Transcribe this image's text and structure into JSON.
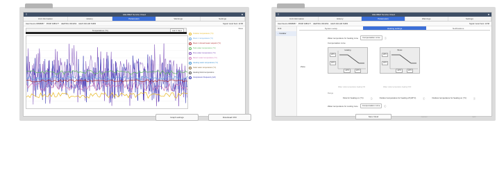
{
  "left": {
    "title": "HELIMEX Service Cloud",
    "nav": [
      "Unit information",
      "History",
      "Parameters",
      "Warnings",
      "Settings"
    ],
    "nav_active": 2,
    "sub": [
      "Heat Source 06686857",
      "PUMP 0486177",
      "HEATING 003145A",
      "HEAT AIR-AIR 51683"
    ],
    "sub_right": "Signal: Good  Sent: 13:58",
    "chart_title": "Temperatures (°C)",
    "range_label": "Last 2 days",
    "legend_header": "Show",
    "legend": [
      {
        "label": "Outdoor temperature (°C)",
        "color": "#e8b820"
      },
      {
        "label": "Room 1 temperature (°C)",
        "color": "#6aa8e0"
      },
      {
        "label": "Room 1 Actual heater setpoint (°C)",
        "color": "#b03030"
      },
      {
        "label": "Tank water temperature (°C)",
        "color": "#5fb85f"
      },
      {
        "label": "Flow water temperature (°C)",
        "color": "#7a4ab8"
      },
      {
        "label": "Return water temperature (°C)",
        "color": "#d07ab8"
      },
      {
        "label": "Heating water temperature (°C)",
        "color": "#3b8fd0"
      },
      {
        "label": "Solar water temperature (°C)",
        "color": "#8a6a3a"
      },
      {
        "label": "Heating block temperature",
        "color": "#4a4a4a"
      },
      {
        "label": "Compressor Frequency (Hz)",
        "color": "#2b2bb0"
      }
    ],
    "buttons": [
      "Graph settings",
      "Download CSV"
    ]
  },
  "right": {
    "title": "HELIMEX Service Cloud",
    "nav": [
      "Unit information",
      "History",
      "Parameters",
      "Warnings",
      "Settings"
    ],
    "nav_active": 2,
    "sub": [
      "Heat Source 06686857",
      "PUMP 0486177",
      "HEATING 003145A",
      "HEAT AIR-AIR 51683"
    ],
    "sub_right": "Signal: Good  Sent: 13:58",
    "side": [
      "Unit",
      "Installer"
    ],
    "tabs": [
      "System setup",
      "Heating settings",
      "Notifications"
    ],
    "tabs_active": 1,
    "block_label": "Zone",
    "water_temp_label": "Water temperature for heating zone",
    "water_temp_value": "Compensation curve",
    "curve_label": "Compensation curve",
    "curves": [
      {
        "title": "Heating",
        "t1": "28°C",
        "t2": "20°C",
        "o1": "-20°C",
        "o2": "20°C"
      },
      {
        "title": "Boost",
        "t1": "28°C",
        "t2": "20°C",
        "o1": "-20°C",
        "o2": "20°C"
      }
    ],
    "note1": "Water outlet temperature heating ON",
    "note2": "Water outlet temperature heating OFF",
    "section2": "Range",
    "fields": [
      "Flow for heating on (°C)",
      "Outdoor temperature for heating off (20°C)",
      "Outdoor temperature for heating on (°C)"
    ],
    "water_temp2_label": "Water temperature for cooling zone",
    "water_temp2_value": "Compensation curve",
    "buttons": [
      "Save Cloud",
      "Cancel",
      "Edit"
    ]
  }
}
